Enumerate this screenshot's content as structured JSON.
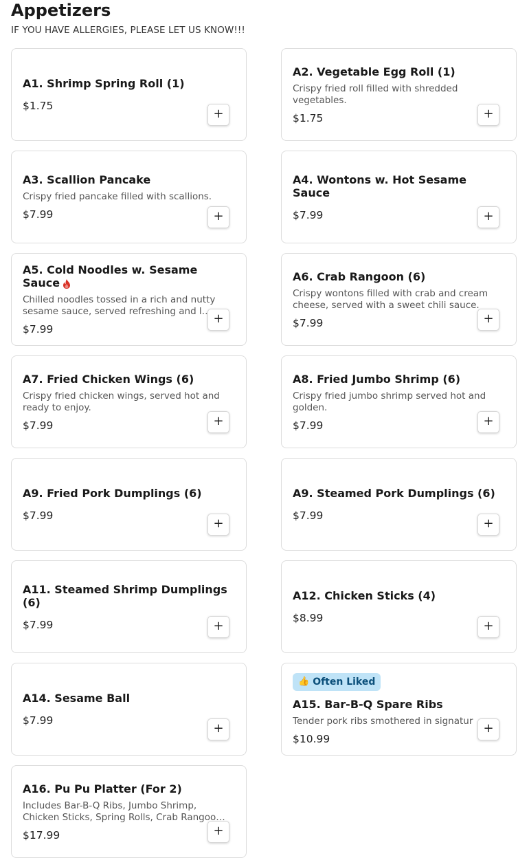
{
  "header": {
    "title": "Appetizers",
    "notice": "IF YOU HAVE ALLERGIES, PLEASE LET US KNOW!!!"
  },
  "items": [
    {
      "name": "A1. Shrimp Spring Roll (1)",
      "desc": "",
      "price": "$1.75"
    },
    {
      "name": "A2. Vegetable Egg Roll (1)",
      "desc": "Crispy fried roll filled with shredded vegetables.",
      "price": "$1.75"
    },
    {
      "name": "A3. Scallion Pancake",
      "desc": "Crispy fried pancake filled with scallions.",
      "price": "$7.99"
    },
    {
      "name": "A4. Wontons w. Hot Sesame Sauce",
      "desc": "",
      "price": "$7.99"
    },
    {
      "name": "A5. Cold Noodles w. Sesame Sauce",
      "desc": "Chilled noodles tossed in a rich and nutty sesame sauce, served refreshing and l…",
      "price": "$7.99",
      "spicy": true
    },
    {
      "name": "A6. Crab Rangoon (6)",
      "desc": "Crispy wontons filled with crab and cream cheese, served with a sweet chili sauce.",
      "price": "$7.99"
    },
    {
      "name": "A7. Fried Chicken Wings (6)",
      "desc": "Crispy fried chicken wings, served hot and ready to enjoy.",
      "price": "$7.99"
    },
    {
      "name": "A8. Fried Jumbo Shrimp (6)",
      "desc": "Crispy fried jumbo shrimp served hot and golden.",
      "price": "$7.99"
    },
    {
      "name": "A9. Fried Pork Dumplings (6)",
      "desc": "",
      "price": "$7.99"
    },
    {
      "name": "A9. Steamed Pork Dumplings (6)",
      "desc": "",
      "price": "$7.99"
    },
    {
      "name": "A11. Steamed Shrimp Dumplings (6)",
      "desc": "",
      "price": "$7.99"
    },
    {
      "name": "A12. Chicken Sticks (4)",
      "desc": "",
      "price": "$8.99"
    },
    {
      "name": "A14. Sesame Ball",
      "desc": "",
      "price": "$7.99"
    },
    {
      "name": "A15. Bar-B-Q Spare Ribs",
      "desc": "Tender pork ribs smothered in signatur",
      "price": "$10.99",
      "badge": "Often Liked"
    },
    {
      "name": "A16. Pu Pu Platter (For 2)",
      "desc": "Includes Bar-B-Q Ribs, Jumbo Shrimp, Chicken Sticks, Spring Rolls, Crab Rangoo…",
      "price": "$17.99"
    }
  ],
  "add_button_label": "+",
  "icons": {
    "spicy": "flame-icon",
    "badge": "thumbs-up-icon"
  },
  "colors": {
    "badge_bg": "#bfe3f7",
    "badge_text": "#0b4f7a",
    "spicy": "#d93025"
  }
}
